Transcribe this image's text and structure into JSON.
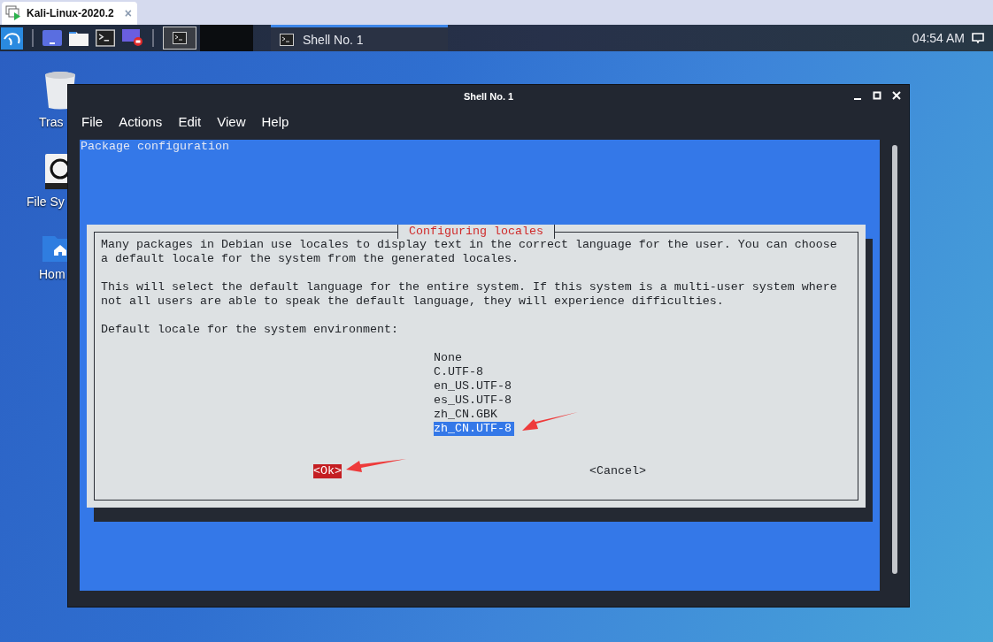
{
  "vm_tab": {
    "title": "Kali-Linux-2020.2",
    "close": "×"
  },
  "taskbar": {
    "task": "Shell No. 1",
    "clock": "04:54 AM"
  },
  "desktop_icons": [
    {
      "kind": "trash",
      "label": "Tras"
    },
    {
      "kind": "drive",
      "label": "File Sy"
    },
    {
      "kind": "home",
      "label": "Hom"
    }
  ],
  "window": {
    "title": "Shell No. 1",
    "menu": [
      "File",
      "Actions",
      "Edit",
      "View",
      "Help"
    ]
  },
  "terminal": {
    "header": "Package configuration",
    "dialog": {
      "title": "Configuring locales",
      "paragraphs": [
        "Many packages in Debian use locales to display text in the correct language for the user. You can choose\na default locale for the system from the generated locales.",
        "This will select the default language for the entire system. If this system is a multi-user system where\nnot all users are able to speak the default language, they will experience difficulties.",
        "Default locale for the system environment:"
      ],
      "options": [
        {
          "label": "None",
          "selected": false
        },
        {
          "label": "C.UTF-8",
          "selected": false
        },
        {
          "label": "en_US.UTF-8",
          "selected": false
        },
        {
          "label": "es_US.UTF-8",
          "selected": false
        },
        {
          "label": "zh_CN.GBK",
          "selected": false
        },
        {
          "label": "zh_CN.UTF-8",
          "selected": true
        }
      ],
      "buttons": [
        {
          "label": "<Ok>",
          "selected": true
        },
        {
          "label": "<Cancel>",
          "selected": false
        }
      ]
    }
  }
}
